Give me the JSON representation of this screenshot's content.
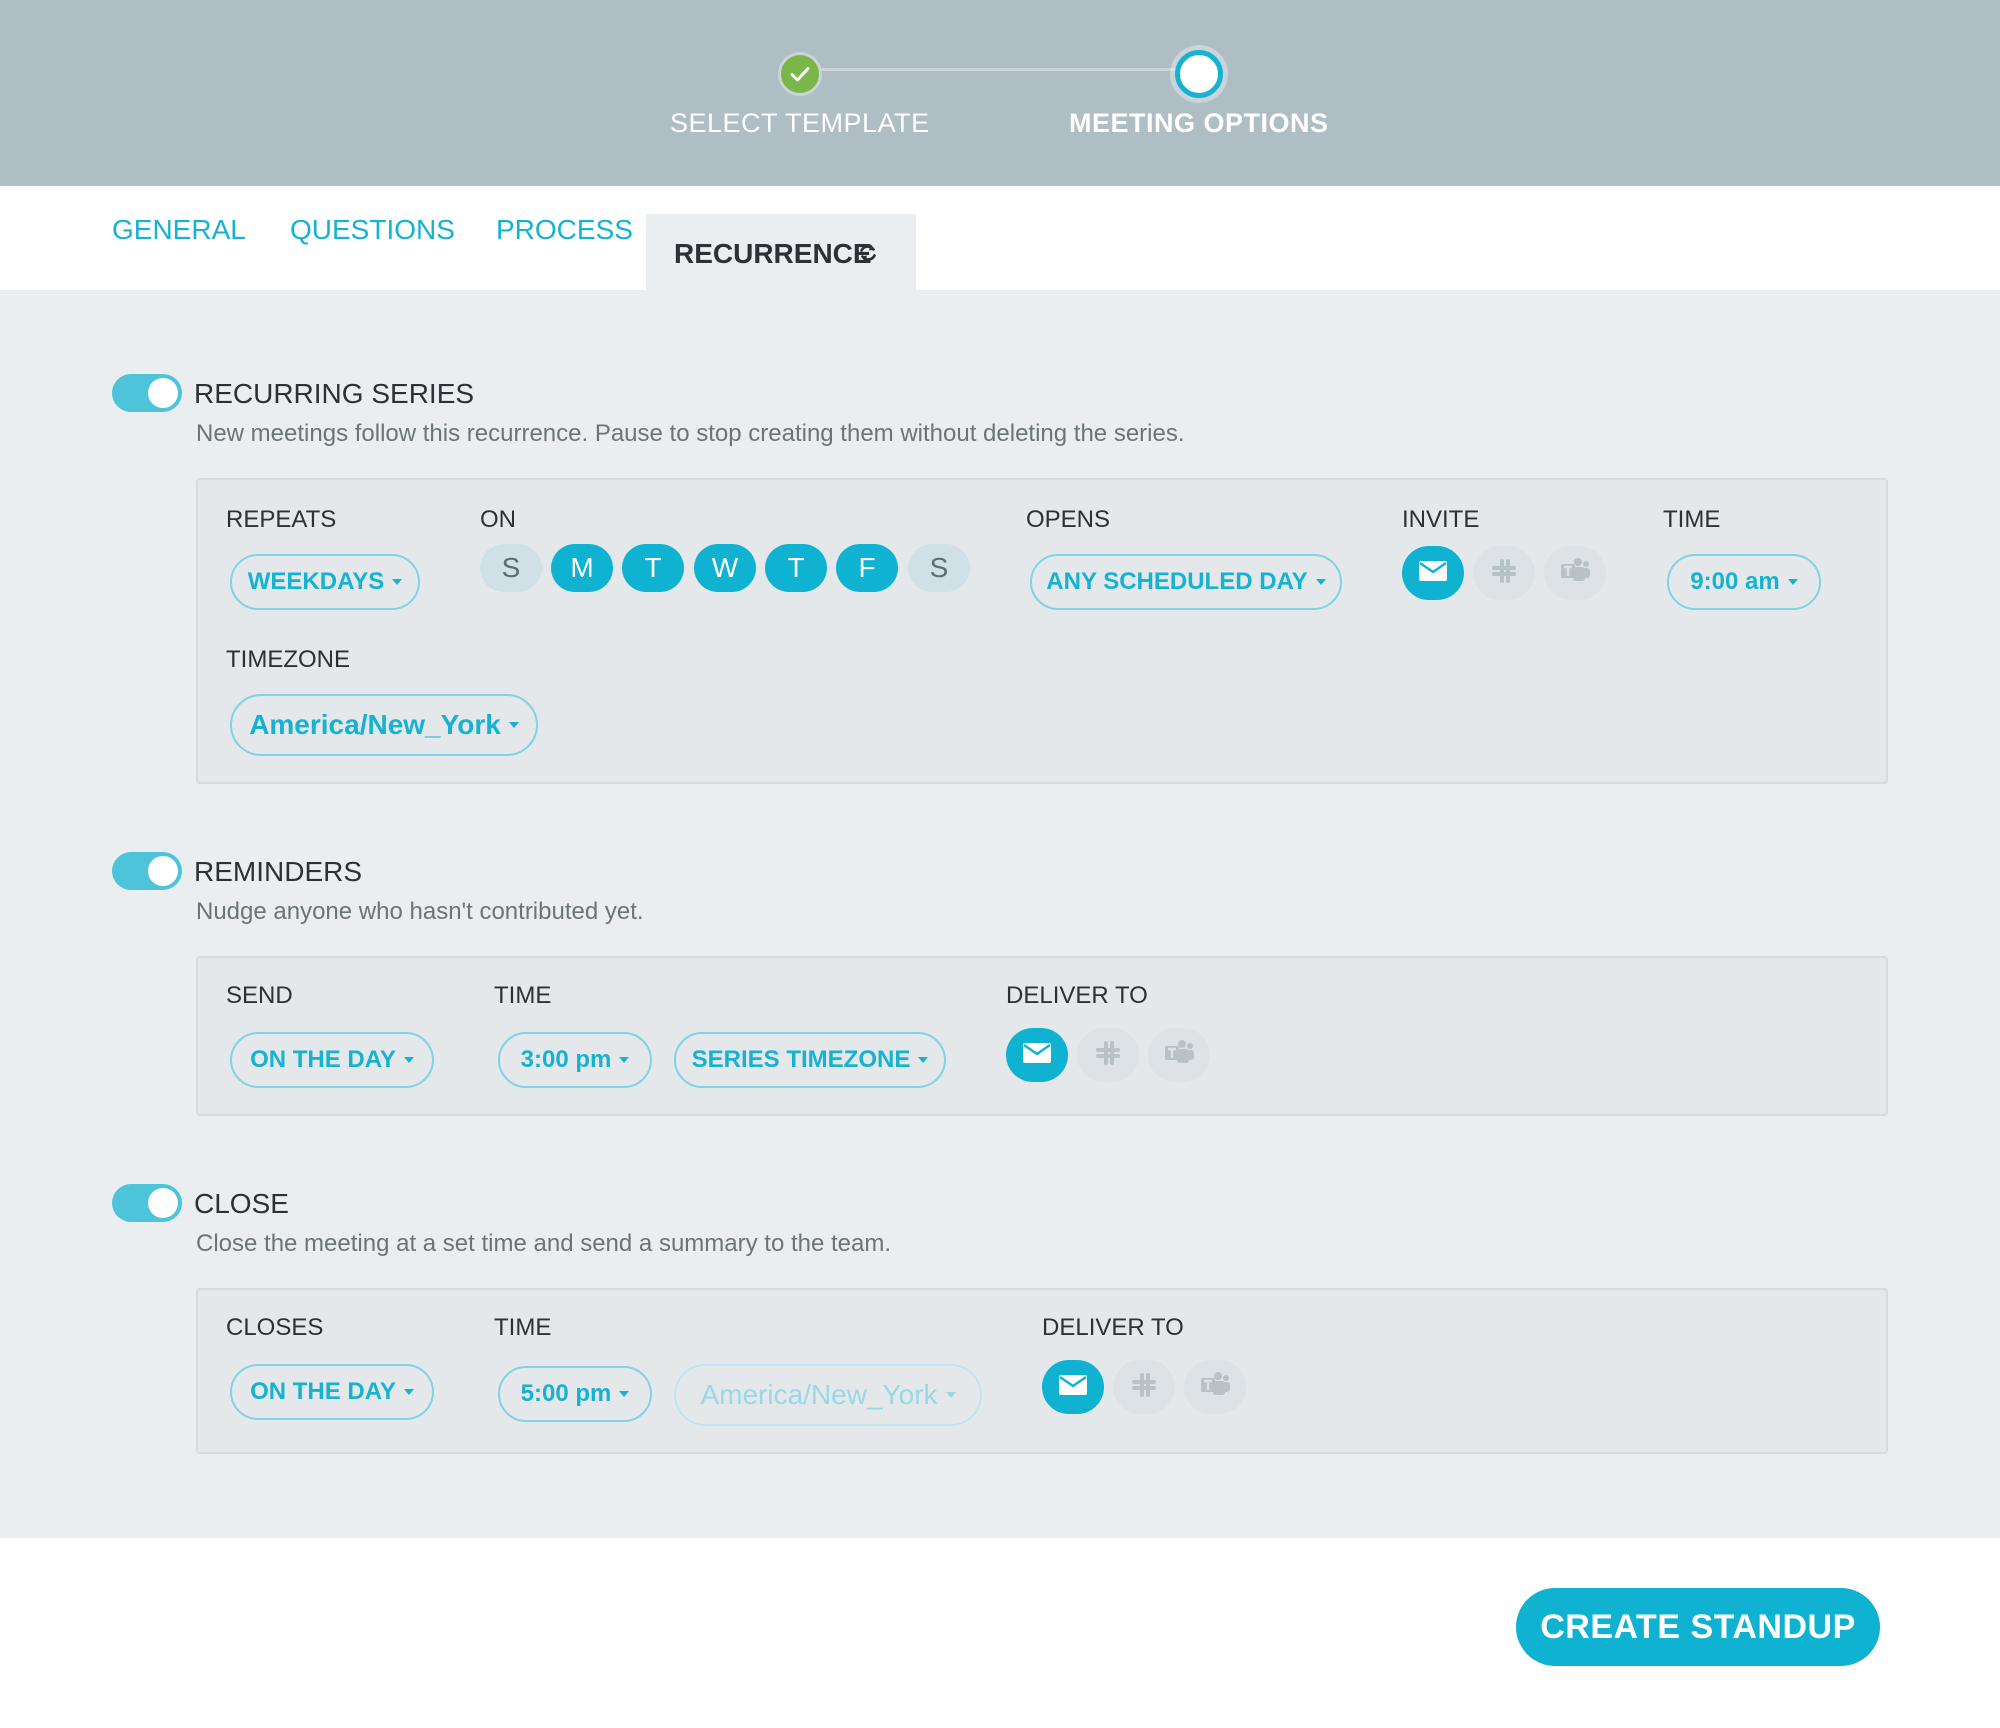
{
  "stepper": {
    "steps": [
      {
        "label": "SELECT TEMPLATE",
        "state": "done"
      },
      {
        "label": "MEETING OPTIONS",
        "state": "current"
      }
    ]
  },
  "tabs": [
    {
      "label": "GENERAL",
      "active": false
    },
    {
      "label": "QUESTIONS",
      "active": false
    },
    {
      "label": "PROCESS",
      "active": false
    },
    {
      "label": "RECURRENCE",
      "active": true,
      "icon": "refresh-icon"
    }
  ],
  "recurring": {
    "title": "RECURRING SERIES",
    "enabled": true,
    "description": "New meetings follow this recurrence. Pause to stop creating them without deleting the series.",
    "repeats_label": "REPEATS",
    "repeats_value": "WEEKDAYS",
    "on_label": "ON",
    "days": [
      {
        "letter": "S",
        "selected": false
      },
      {
        "letter": "M",
        "selected": true
      },
      {
        "letter": "T",
        "selected": true
      },
      {
        "letter": "W",
        "selected": true
      },
      {
        "letter": "T",
        "selected": true
      },
      {
        "letter": "F",
        "selected": true
      },
      {
        "letter": "S",
        "selected": false
      }
    ],
    "opens_label": "OPENS",
    "opens_value": "ANY SCHEDULED DAY",
    "invite_label": "INVITE",
    "invite_channels": [
      {
        "icon": "email-icon",
        "selected": true
      },
      {
        "icon": "slack-icon",
        "selected": false
      },
      {
        "icon": "teams-icon",
        "selected": false
      }
    ],
    "time_label": "TIME",
    "time_value": "9:00 am",
    "timezone_label": "TIMEZONE",
    "timezone_value": "America/New_York"
  },
  "reminders": {
    "title": "REMINDERS",
    "enabled": true,
    "description": "Nudge anyone who hasn't contributed yet.",
    "send_label": "SEND",
    "send_value": "ON THE DAY",
    "time_label": "TIME",
    "time_value": "3:00 pm",
    "timezone_value": "SERIES TIMEZONE",
    "deliver_label": "DELIVER TO",
    "channels": [
      {
        "icon": "email-icon",
        "selected": true
      },
      {
        "icon": "slack-icon",
        "selected": false
      },
      {
        "icon": "teams-icon",
        "selected": false
      }
    ]
  },
  "close": {
    "title": "CLOSE",
    "enabled": true,
    "description": "Close the meeting at a set time and send a summary to the team.",
    "closes_label": "CLOSES",
    "closes_value": "ON THE DAY",
    "time_label": "TIME",
    "time_value": "5:00 pm",
    "timezone_value": "America/New_York",
    "deliver_label": "DELIVER TO",
    "channels": [
      {
        "icon": "email-icon",
        "selected": true
      },
      {
        "icon": "slack-icon",
        "selected": false
      },
      {
        "icon": "teams-icon",
        "selected": false
      }
    ]
  },
  "footer": {
    "create_label": "CREATE STANDUP"
  },
  "colors": {
    "accent": "#0fb2d1",
    "header_bg": "#afbdc4",
    "done_green": "#7ab648",
    "panel_bg": "#ebeef1"
  }
}
